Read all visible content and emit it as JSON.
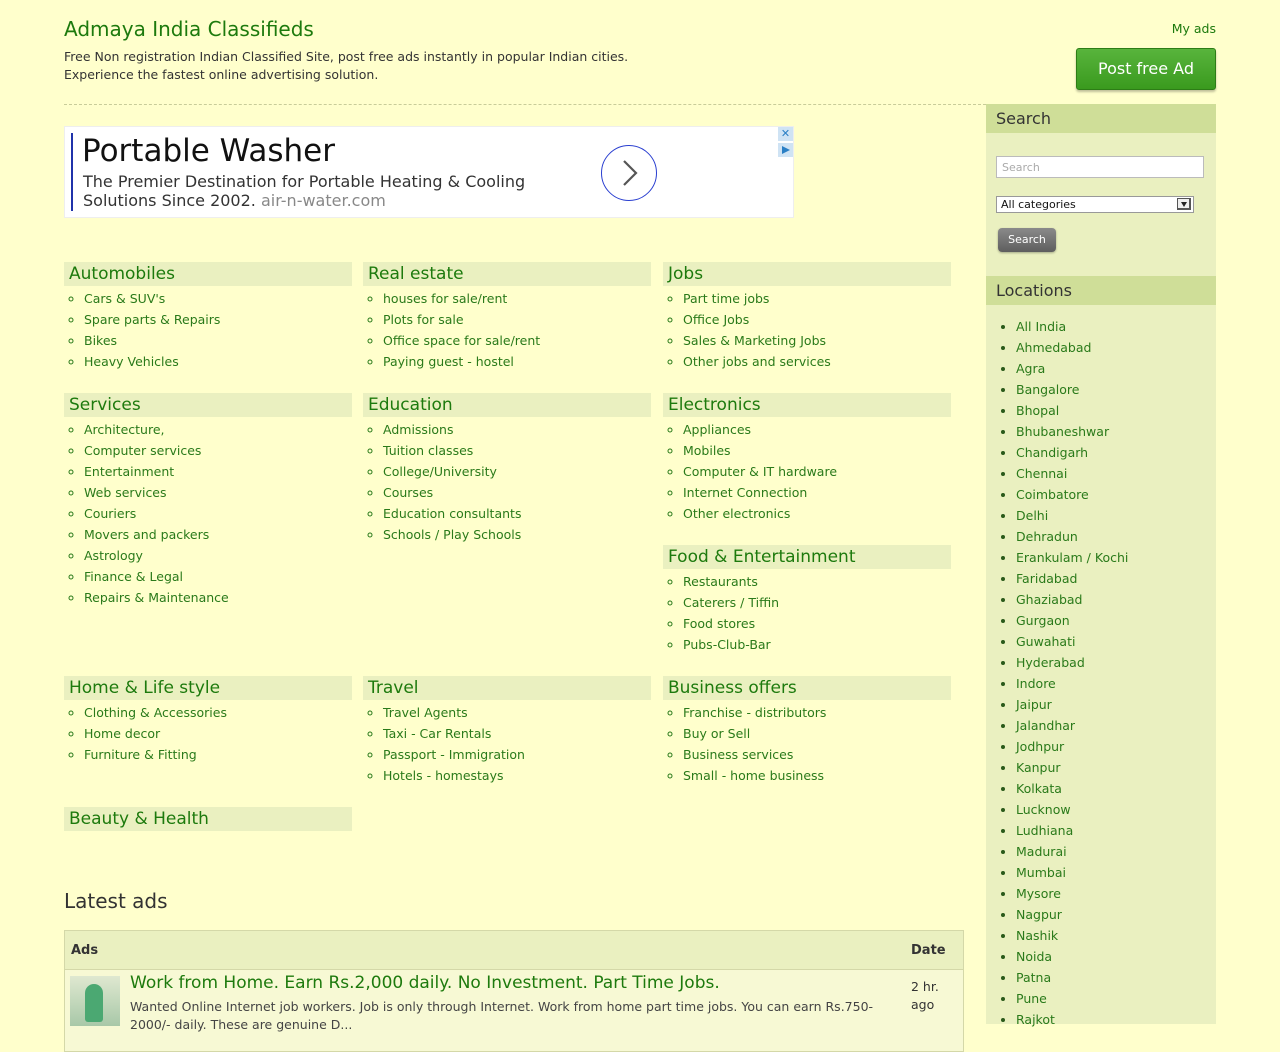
{
  "header": {
    "site_title": "Admaya India Classifieds",
    "tagline": "Free Non registration Indian Classified Site, post free ads instantly in popular Indian cities. Experience the fastest online advertising solution.",
    "my_ads_label": "My ads",
    "post_ad_label": "Post free Ad"
  },
  "advert": {
    "title": "Portable Washer",
    "body": "The Premier Destination for Portable Heating & Cooling Solutions Since 2002.",
    "url": "air-n-water.com",
    "close_glyph": "✕"
  },
  "categories": [
    {
      "title": "Automobiles",
      "items": [
        "Cars & SUV's",
        "Spare parts & Repairs",
        "Bikes",
        "Heavy Vehicles"
      ]
    },
    {
      "title": "Real estate",
      "items": [
        "houses for sale/rent",
        "Plots for sale",
        "Office space for sale/rent",
        "Paying guest - hostel"
      ]
    },
    {
      "title": "Jobs",
      "items": [
        "Part time jobs",
        "Office Jobs",
        "Sales & Marketing Jobs",
        "Other jobs and services"
      ]
    },
    {
      "title": "Services",
      "items": [
        "Architecture,",
        "Computer services",
        "Entertainment",
        "Web services",
        "Couriers",
        "Movers and packers",
        "Astrology",
        "Finance & Legal",
        "Repairs & Maintenance"
      ]
    },
    {
      "title": "Education",
      "items": [
        "Admissions",
        "Tuition classes",
        "College/University",
        "Courses",
        "Education consultants",
        "Schools / Play Schools"
      ]
    },
    {
      "title": "Electronics",
      "items": [
        "Appliances",
        "Mobiles",
        "Computer & IT hardware",
        "Internet Connection",
        "Other electronics"
      ]
    },
    {
      "title": "Food & Entertainment",
      "items": [
        "Restaurants",
        "Caterers / Tiffin",
        "Food stores",
        "Pubs-Club-Bar"
      ]
    },
    {
      "title": "Home & Life style",
      "items": [
        "Clothing & Accessories",
        "Home decor",
        "Furniture & Fitting"
      ]
    },
    {
      "title": "Travel",
      "items": [
        "Travel Agents",
        "Taxi - Car Rentals",
        "Passport - Immigration",
        "Hotels - homestays"
      ]
    },
    {
      "title": "Business offers",
      "items": [
        "Franchise - distributors",
        "Buy or Sell",
        "Business services",
        "Small - home business"
      ]
    },
    {
      "title": "Beauty & Health",
      "items": []
    }
  ],
  "latest": {
    "title": "Latest ads",
    "col_ads": "Ads",
    "col_date": "Date",
    "rows": [
      {
        "title": "Work from Home. Earn Rs.2,000 daily. No Investment. Part Time Jobs.",
        "desc": "Wanted Online Internet job workers. Job is only through Internet. Work from home part time jobs. You can earn Rs.750-2000/- daily. These are genuine D...",
        "date": "2 hr. ago"
      }
    ]
  },
  "sidebar": {
    "search_title": "Search",
    "search_placeholder": "Search",
    "category_selected": "All categories",
    "search_button": "Search",
    "locations_title": "Locations",
    "locations": [
      "All India",
      "Ahmedabad",
      "Agra",
      "Bangalore",
      "Bhopal",
      "Bhubaneshwar",
      "Chandigarh",
      "Chennai",
      "Coimbatore",
      "Delhi",
      "Dehradun",
      "Erankulam / Kochi",
      "Faridabad",
      "Ghaziabad",
      "Gurgaon",
      "Guwahati",
      "Hyderabad",
      "Indore",
      "Jaipur",
      "Jalandhar",
      "Jodhpur",
      "Kanpur",
      "Kolkata",
      "Lucknow",
      "Ludhiana",
      "Madurai",
      "Mumbai",
      "Mysore",
      "Nagpur",
      "Nashik",
      "Noida",
      "Patna",
      "Pune",
      "Rajkot"
    ]
  }
}
